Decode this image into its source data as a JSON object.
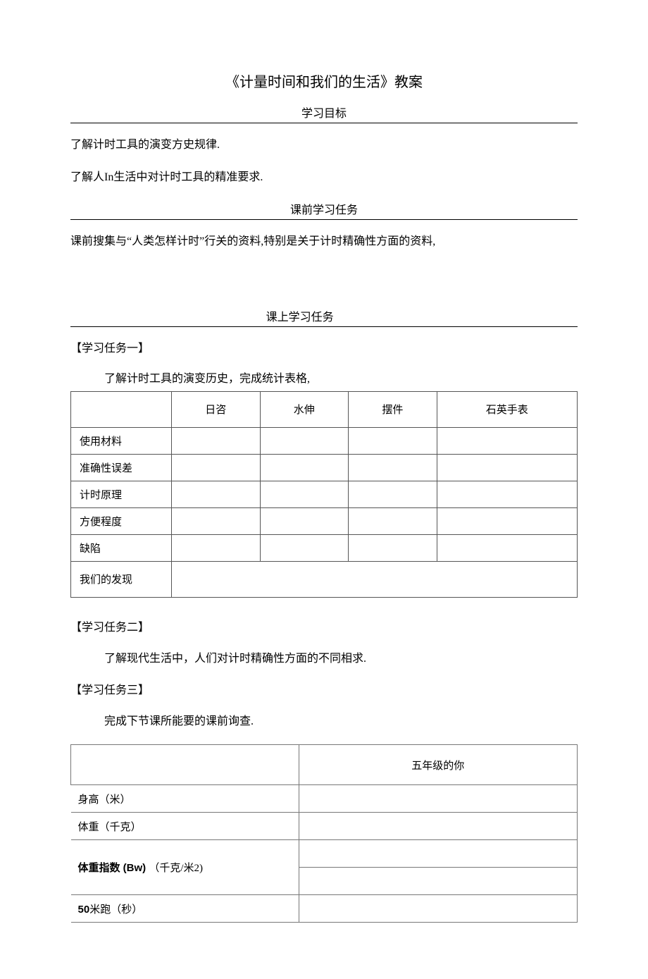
{
  "title": "《计量时间和我们的生活》教案",
  "sections": {
    "goals_header": "学习目标",
    "goal_1": "了解计时工具的演变方史规律.",
    "goal_2": "了解人In生活中对计时工具的精准要求.",
    "pre_header": "课前学习任务",
    "pre_text": "课前搜集与“人类怎样计时”行关的资料,特别是关于计时精确性方面的资料,",
    "in_header": "课上学习任务"
  },
  "tasks": {
    "t1": {
      "heading": "【学习任务一】",
      "desc": "了解计时工具的演变历史，完成统计表格,"
    },
    "t2": {
      "heading": "【学习任务二】",
      "desc": "了解现代生活中，人们对计时精确性方面的不同相求."
    },
    "t3": {
      "heading": "【学习任务三】",
      "desc": "完成下节课所能要的课前询查."
    }
  },
  "table1": {
    "cols": [
      "",
      "日咨",
      "水伸",
      "摆件",
      "石英手表"
    ],
    "rows": [
      "使用材料",
      "准确性误差",
      "计时原理",
      "方便程度",
      "缺陷",
      "我们的发现"
    ]
  },
  "table2": {
    "header_right": "五年级的你",
    "rows": [
      {
        "label": "身高（米）"
      },
      {
        "label": "体重（千克）"
      },
      {
        "label_bold_prefix": "体重指数 (Bw) ",
        "label_rest": "（千克/米2)"
      },
      {
        "label": ""
      },
      {
        "label_bold_prefix": "50",
        "label_rest": "米跑（秒）"
      }
    ]
  }
}
